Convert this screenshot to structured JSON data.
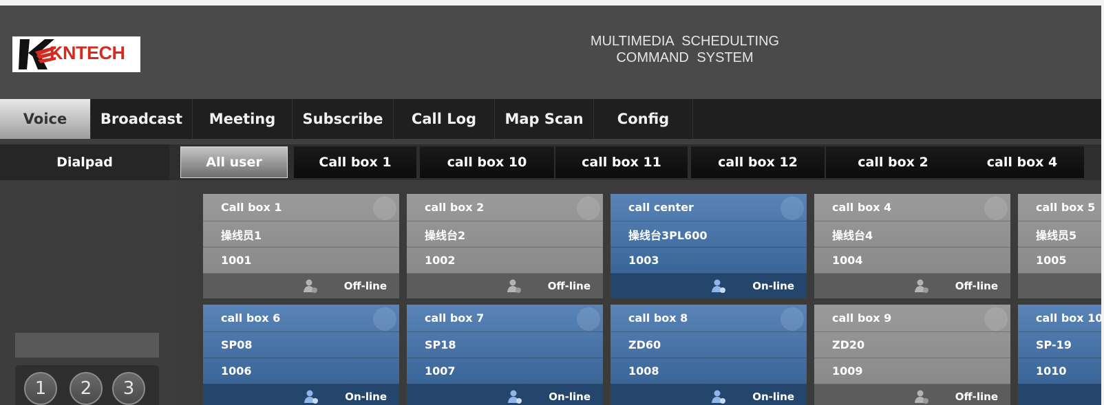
{
  "header": {
    "logo_text": "KNTECH",
    "title_line1": "MULTIMEDIA  SCHEDULTING",
    "title_line2": "COMMAND  SYSTEM"
  },
  "main_nav": [
    {
      "label": "Voice",
      "active": true
    },
    {
      "label": "Broadcast"
    },
    {
      "label": "Meeting"
    },
    {
      "label": "Subscribe"
    },
    {
      "label": "Call Log"
    },
    {
      "label": "Map Scan"
    },
    {
      "label": "Config"
    }
  ],
  "sub_nav": [
    {
      "label": "Dialpad"
    },
    {
      "label": "All user",
      "active": true
    },
    {
      "label": "Call box 1"
    },
    {
      "label": "call box 10"
    },
    {
      "label": "call box 11"
    },
    {
      "label": "call box 12"
    },
    {
      "label": "call box 2"
    },
    {
      "label": "call box 4"
    }
  ],
  "dialpad": {
    "input_value": "",
    "keys": [
      "1",
      "2",
      "3"
    ]
  },
  "cards": [
    {
      "name": "Call box 1",
      "user": "操线员1",
      "number": "1001",
      "status": "Off-line",
      "online": false
    },
    {
      "name": "call box 2",
      "user": "操线台2",
      "number": "1002",
      "status": "Off-line",
      "online": false
    },
    {
      "name": "call center",
      "user": "操线台3PL600",
      "number": "1003",
      "status": "On-line",
      "online": true
    },
    {
      "name": "call box 4",
      "user": "操线台4",
      "number": "1004",
      "status": "Off-line",
      "online": false
    },
    {
      "name": "call box 5",
      "user": "操线员5",
      "number": "1005",
      "status": "",
      "online": false
    },
    {
      "name": "call box 6",
      "user": "SP08",
      "number": "1006",
      "status": "On-line",
      "online": true
    },
    {
      "name": "call box 7",
      "user": "SP18",
      "number": "1007",
      "status": "On-line",
      "online": true
    },
    {
      "name": "call box 8",
      "user": "ZD60",
      "number": "1008",
      "status": "On-line",
      "online": true
    },
    {
      "name": "call box 9",
      "user": "ZD20",
      "number": "1009",
      "status": "Off-line",
      "online": false
    },
    {
      "name": "call box 10",
      "user": "SP-19",
      "number": "1010",
      "status": "",
      "online": true
    }
  ],
  "colors": {
    "online_card": "#3d6a9e",
    "offline_card": "#8e8e8e",
    "logo_red": "#d42a20"
  }
}
